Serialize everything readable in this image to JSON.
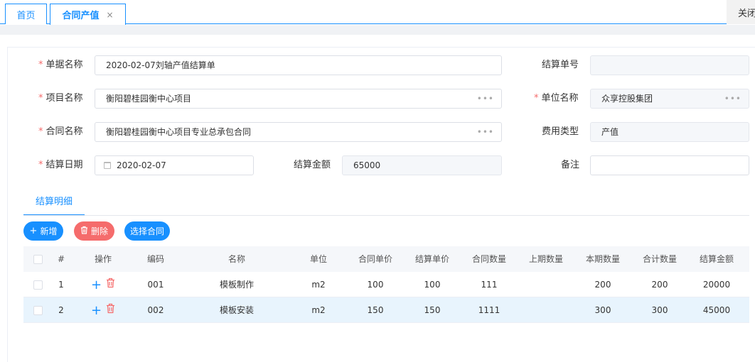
{
  "tabs": {
    "home": "首页",
    "active": "合同产值",
    "active_close": "×",
    "close_all": "关闭"
  },
  "form": {
    "doc_name_label": "单据名称",
    "doc_name_value": "2020-02-07刘轴产值结算单",
    "settle_no_label": "结算单号",
    "settle_no_value": "",
    "project_label": "项目名称",
    "project_value": "衡阳碧桂园衡中心项目",
    "unit_label": "单位名称",
    "unit_value": "众享控股集团",
    "contract_label": "合同名称",
    "contract_value": "衡阳碧桂园衡中心项目专业总承包合同",
    "fee_type_label": "费用类型",
    "fee_type_value": "产值",
    "date_label": "结算日期",
    "date_value": "2020-02-07",
    "amount_label": "结算金额",
    "amount_value": "65000",
    "remark_label": "备注",
    "remark_value": "",
    "required_mark": "*",
    "picker_dots": "•••"
  },
  "detail": {
    "tab_label": "结算明细",
    "add_button": "新增",
    "delete_button": "删除",
    "select_contract_button": "选择合同",
    "columns": [
      "#",
      "操作",
      "编码",
      "名称",
      "单位",
      "合同单价",
      "结算单价",
      "合同数量",
      "上期数量",
      "本期数量",
      "合计数量",
      "结算金额"
    ],
    "rows": [
      {
        "no": "1",
        "code": "001",
        "name": "模板制作",
        "unit": "m2",
        "contract_price": "100",
        "settle_price": "100",
        "contract_qty": "111",
        "prev_qty": "",
        "curr_qty": "200",
        "total_qty": "200",
        "amount": "20000"
      },
      {
        "no": "2",
        "code": "002",
        "name": "模板安装",
        "unit": "m2",
        "contract_price": "150",
        "settle_price": "150",
        "contract_qty": "1111",
        "prev_qty": "",
        "curr_qty": "300",
        "total_qty": "300",
        "amount": "45000"
      }
    ]
  },
  "colors": {
    "primary": "#1890ff",
    "danger": "#f56c6c",
    "required": "#f56c6c",
    "row_highlight": "#e8f4fd"
  }
}
